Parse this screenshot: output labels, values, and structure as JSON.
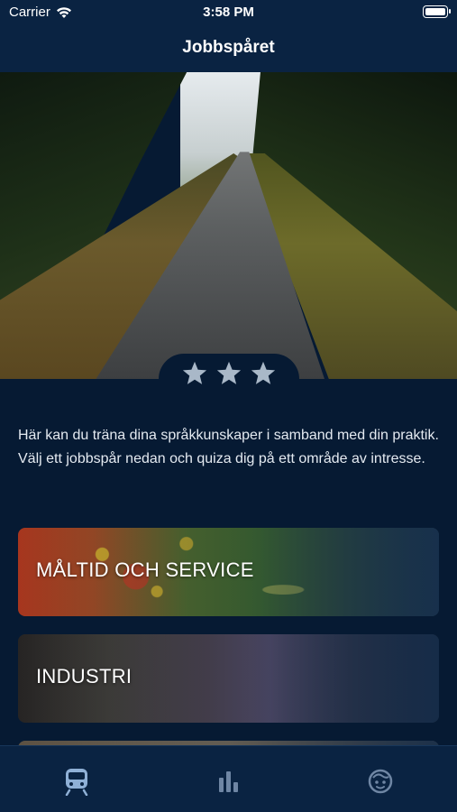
{
  "status_bar": {
    "carrier": "Carrier",
    "time": "3:58 PM",
    "wifi_icon": "wifi-icon",
    "battery_icon": "battery-icon"
  },
  "nav": {
    "title": "Jobbspåret"
  },
  "hero": {
    "image": "forest-path-photo",
    "stars_filled": 3,
    "star_color": "#a9b8c8"
  },
  "intro_text": "Här kan du träna dina språkkunskaper i samband med din praktik. Välj ett jobbspår nedan och quiza dig på ett område av intresse.",
  "cards": [
    {
      "label": "MÅLTID OCH SERVICE",
      "image": "food-photo"
    },
    {
      "label": "INDUSTRI",
      "image": "industry-photo"
    }
  ],
  "tab_bar": {
    "items": [
      {
        "icon": "train-icon",
        "active": true
      },
      {
        "icon": "bar-chart-icon",
        "active": false
      },
      {
        "icon": "face-icon",
        "active": false
      }
    ],
    "active_color": "#8fb0d6",
    "inactive_color": "#6f86a4"
  },
  "colors": {
    "background": "#061a33",
    "bar": "#0a2342"
  }
}
